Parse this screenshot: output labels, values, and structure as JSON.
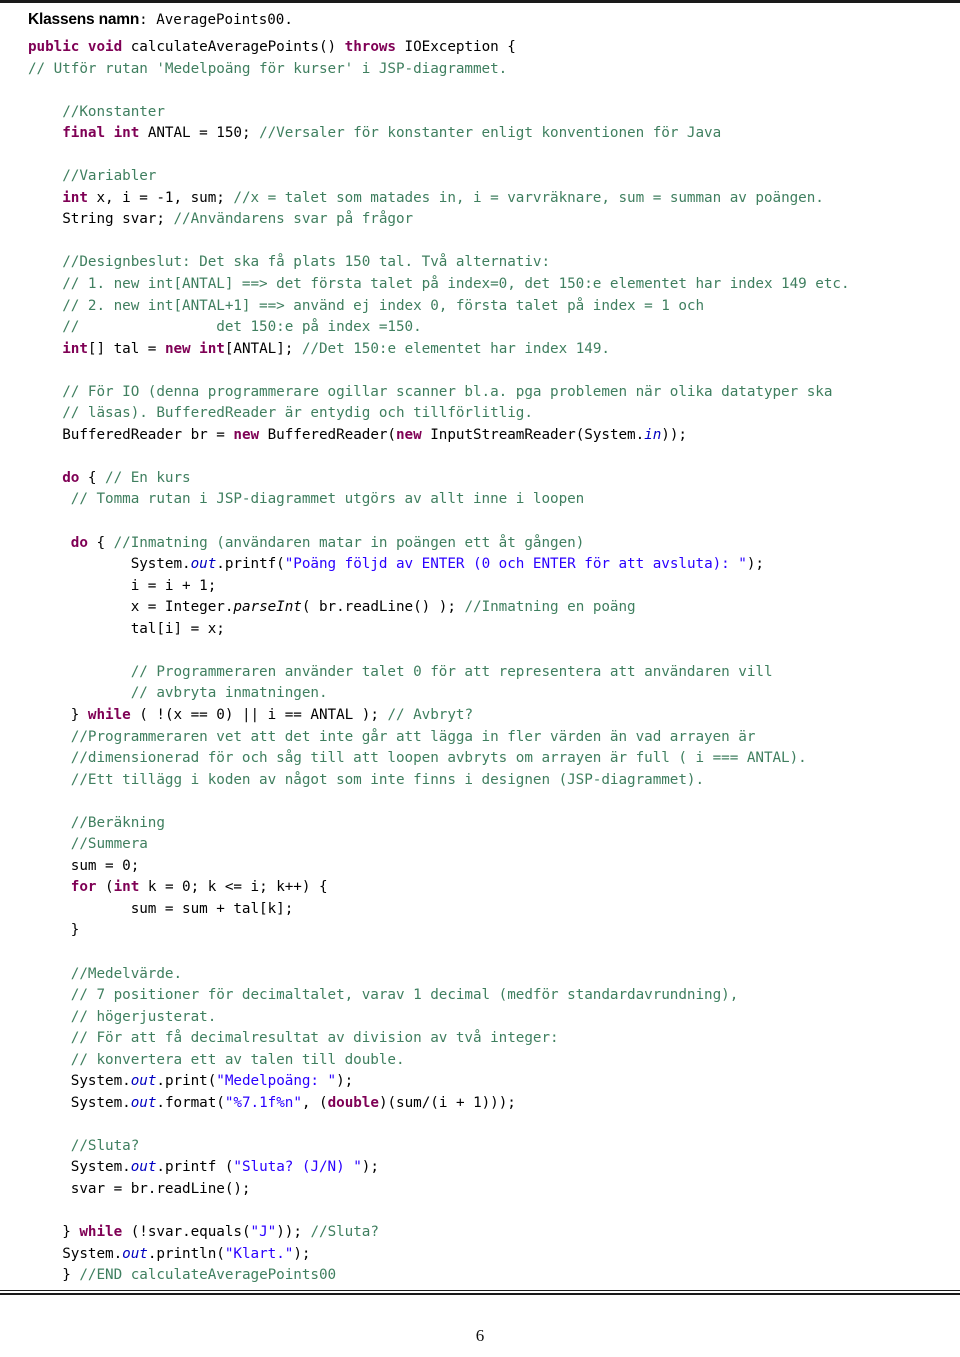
{
  "document": {
    "heading_label": "Klassens namn",
    "heading_value": ": AveragePoints00.",
    "page_number": "6",
    "colors": {
      "keyword": "#7f0055",
      "comment": "#3f7f5f",
      "string": "#2a00ff",
      "field": "#0000c0",
      "text": "#000000",
      "background": "#ffffff",
      "rule": "#1a1a1a"
    }
  },
  "code": {
    "language": "Java",
    "lines": [
      {
        "id": 1,
        "segments": [
          {
            "t": "kw",
            "s": "public void "
          },
          {
            "t": "pln",
            "s": "calculateAveragePoints() "
          },
          {
            "t": "kw",
            "s": "throws "
          },
          {
            "t": "pln",
            "s": "IOException {"
          }
        ]
      },
      {
        "id": 2,
        "segments": [
          {
            "t": "cmt",
            "s": "// Utför rutan 'Medelpoäng för kurser' i JSP-diagrammet."
          }
        ]
      },
      {
        "id": 3,
        "segments": []
      },
      {
        "id": 4,
        "segments": [
          {
            "t": "cmt",
            "s": "    //Konstanter"
          }
        ]
      },
      {
        "id": 5,
        "segments": [
          {
            "t": "kw",
            "s": "    final int "
          },
          {
            "t": "pln",
            "s": "ANTAL = 150; "
          },
          {
            "t": "cmt",
            "s": "//Versaler för konstanter enligt konventionen för Java"
          }
        ]
      },
      {
        "id": 6,
        "segments": []
      },
      {
        "id": 7,
        "segments": [
          {
            "t": "cmt",
            "s": "    //Variabler"
          }
        ]
      },
      {
        "id": 8,
        "segments": [
          {
            "t": "kw",
            "s": "    int "
          },
          {
            "t": "pln",
            "s": "x, i = -1, sum; "
          },
          {
            "t": "cmt",
            "s": "//x = talet som matades in, i = varvräknare, sum = summan av poängen."
          }
        ]
      },
      {
        "id": 9,
        "segments": [
          {
            "t": "pln",
            "s": "    String svar; "
          },
          {
            "t": "cmt",
            "s": "//Användarens svar på frågor"
          }
        ]
      },
      {
        "id": 10,
        "segments": []
      },
      {
        "id": 11,
        "segments": [
          {
            "t": "cmt",
            "s": "    //Designbeslut: Det ska få plats 150 tal. Två alternativ:"
          }
        ]
      },
      {
        "id": 12,
        "segments": [
          {
            "t": "cmt",
            "s": "    // 1. new int[ANTAL] ==> det första talet på index=0, det 150:e elementet har index 149 etc."
          }
        ]
      },
      {
        "id": 13,
        "segments": [
          {
            "t": "cmt",
            "s": "    // 2. new int[ANTAL+1] ==> använd ej index 0, första talet på index = 1 och"
          }
        ]
      },
      {
        "id": 14,
        "segments": [
          {
            "t": "cmt",
            "s": "    //                det 150:e på index =150."
          }
        ]
      },
      {
        "id": 15,
        "segments": [
          {
            "t": "kw",
            "s": "    int"
          },
          {
            "t": "pln",
            "s": "[] tal = "
          },
          {
            "t": "kw",
            "s": "new int"
          },
          {
            "t": "pln",
            "s": "[ANTAL]; "
          },
          {
            "t": "cmt",
            "s": "//Det 150:e elementet har index 149."
          }
        ]
      },
      {
        "id": 16,
        "segments": []
      },
      {
        "id": 17,
        "segments": [
          {
            "t": "cmt",
            "s": "    // För IO (denna programmerare ogillar scanner bl.a. pga problemen när olika datatyper ska"
          }
        ]
      },
      {
        "id": 18,
        "segments": [
          {
            "t": "cmt",
            "s": "    // läsas). BufferedReader är entydig och tillförlitlig."
          }
        ]
      },
      {
        "id": 19,
        "segments": [
          {
            "t": "pln",
            "s": "    BufferedReader br = "
          },
          {
            "t": "kw",
            "s": "new "
          },
          {
            "t": "pln",
            "s": "BufferedReader("
          },
          {
            "t": "kw",
            "s": "new "
          },
          {
            "t": "pln",
            "s": "InputStreamReader(System."
          },
          {
            "t": "fld",
            "s": "in"
          },
          {
            "t": "pln",
            "s": "));"
          }
        ]
      },
      {
        "id": 20,
        "segments": []
      },
      {
        "id": 21,
        "segments": [
          {
            "t": "kw",
            "s": "    do "
          },
          {
            "t": "pln",
            "s": "{ "
          },
          {
            "t": "cmt",
            "s": "// En kurs"
          }
        ]
      },
      {
        "id": 22,
        "segments": [
          {
            "t": "cmt",
            "s": "     // Tomma rutan i JSP-diagrammet utgörs av allt inne i loopen"
          }
        ]
      },
      {
        "id": 23,
        "segments": []
      },
      {
        "id": 24,
        "segments": [
          {
            "t": "kw",
            "s": "     do "
          },
          {
            "t": "pln",
            "s": "{ "
          },
          {
            "t": "cmt",
            "s": "//Inmatning (användaren matar in poängen ett åt gången)"
          }
        ]
      },
      {
        "id": 25,
        "segments": [
          {
            "t": "pln",
            "s": "            System."
          },
          {
            "t": "fld",
            "s": "out"
          },
          {
            "t": "pln",
            "s": ".printf("
          },
          {
            "t": "str",
            "s": "\"Poäng följd av ENTER (0 och ENTER för att avsluta): \""
          },
          {
            "t": "pln",
            "s": ");"
          }
        ]
      },
      {
        "id": 26,
        "segments": [
          {
            "t": "pln",
            "s": "            i = i + 1;"
          }
        ]
      },
      {
        "id": 27,
        "segments": [
          {
            "t": "pln",
            "s": "            x = Integer."
          },
          {
            "t": "mth",
            "s": "parseInt"
          },
          {
            "t": "pln",
            "s": "( br.readLine() ); "
          },
          {
            "t": "cmt",
            "s": "//Inmatning en poäng"
          }
        ]
      },
      {
        "id": 28,
        "segments": [
          {
            "t": "pln",
            "s": "            tal[i] = x;"
          }
        ]
      },
      {
        "id": 29,
        "segments": []
      },
      {
        "id": 30,
        "segments": [
          {
            "t": "cmt",
            "s": "            // Programmeraren använder talet 0 för att representera att användaren vill"
          }
        ]
      },
      {
        "id": 31,
        "segments": [
          {
            "t": "cmt",
            "s": "            // avbryta inmatningen."
          }
        ]
      },
      {
        "id": 32,
        "segments": [
          {
            "t": "pln",
            "s": "     } "
          },
          {
            "t": "kw",
            "s": "while "
          },
          {
            "t": "pln",
            "s": "( !(x == 0) || i == ANTAL ); "
          },
          {
            "t": "cmt",
            "s": "// Avbryt?"
          }
        ]
      },
      {
        "id": 33,
        "segments": [
          {
            "t": "cmt",
            "s": "     //Programmeraren vet att det inte går att lägga in fler värden än vad arrayen är"
          }
        ]
      },
      {
        "id": 34,
        "segments": [
          {
            "t": "cmt",
            "s": "     //dimensionerad för och såg till att loopen avbryts om arrayen är full ( i === ANTAL)."
          }
        ]
      },
      {
        "id": 35,
        "segments": [
          {
            "t": "cmt",
            "s": "     //Ett tillägg i koden av något som inte finns i designen (JSP-diagrammet)."
          }
        ]
      },
      {
        "id": 36,
        "segments": []
      },
      {
        "id": 37,
        "segments": [
          {
            "t": "cmt",
            "s": "     //Beräkning"
          }
        ]
      },
      {
        "id": 38,
        "segments": [
          {
            "t": "cmt",
            "s": "     //Summera"
          }
        ]
      },
      {
        "id": 39,
        "segments": [
          {
            "t": "pln",
            "s": "     sum = 0;"
          }
        ]
      },
      {
        "id": 40,
        "segments": [
          {
            "t": "kw",
            "s": "     for "
          },
          {
            "t": "pln",
            "s": "("
          },
          {
            "t": "kw",
            "s": "int "
          },
          {
            "t": "pln",
            "s": "k = 0; k <= i; k++) {"
          }
        ]
      },
      {
        "id": 41,
        "segments": [
          {
            "t": "pln",
            "s": "            sum = sum + tal[k];"
          }
        ]
      },
      {
        "id": 42,
        "segments": [
          {
            "t": "pln",
            "s": "     }"
          }
        ]
      },
      {
        "id": 43,
        "segments": []
      },
      {
        "id": 44,
        "segments": [
          {
            "t": "cmt",
            "s": "     //Medelvärde."
          }
        ]
      },
      {
        "id": 45,
        "segments": [
          {
            "t": "cmt",
            "s": "     // 7 positioner för decimaltalet, varav 1 decimal (medför standardavrundning),"
          }
        ]
      },
      {
        "id": 46,
        "segments": [
          {
            "t": "cmt",
            "s": "     // högerjusterat."
          }
        ]
      },
      {
        "id": 47,
        "segments": [
          {
            "t": "cmt",
            "s": "     // För att få decimalresultat av division av två integer:"
          }
        ]
      },
      {
        "id": 48,
        "segments": [
          {
            "t": "cmt",
            "s": "     // konvertera ett av talen till double."
          }
        ]
      },
      {
        "id": 49,
        "segments": [
          {
            "t": "pln",
            "s": "     System."
          },
          {
            "t": "fld",
            "s": "out"
          },
          {
            "t": "pln",
            "s": ".print("
          },
          {
            "t": "str",
            "s": "\"Medelpoäng: \""
          },
          {
            "t": "pln",
            "s": ");"
          }
        ]
      },
      {
        "id": 50,
        "segments": [
          {
            "t": "pln",
            "s": "     System."
          },
          {
            "t": "fld",
            "s": "out"
          },
          {
            "t": "pln",
            "s": ".format("
          },
          {
            "t": "str",
            "s": "\"%7.1f%n\""
          },
          {
            "t": "pln",
            "s": ", ("
          },
          {
            "t": "kw",
            "s": "double"
          },
          {
            "t": "pln",
            "s": ")(sum/(i + 1)));"
          }
        ]
      },
      {
        "id": 51,
        "segments": []
      },
      {
        "id": 52,
        "segments": [
          {
            "t": "cmt",
            "s": "     //Sluta?"
          }
        ]
      },
      {
        "id": 53,
        "segments": [
          {
            "t": "pln",
            "s": "     System."
          },
          {
            "t": "fld",
            "s": "out"
          },
          {
            "t": "pln",
            "s": ".printf ("
          },
          {
            "t": "str",
            "s": "\"Sluta? (J/N) \""
          },
          {
            "t": "pln",
            "s": ");"
          }
        ]
      },
      {
        "id": 54,
        "segments": [
          {
            "t": "pln",
            "s": "     svar = br.readLine();"
          }
        ]
      },
      {
        "id": 55,
        "segments": []
      },
      {
        "id": 56,
        "segments": [
          {
            "t": "pln",
            "s": "    } "
          },
          {
            "t": "kw",
            "s": "while "
          },
          {
            "t": "pln",
            "s": "(!svar.equals("
          },
          {
            "t": "str",
            "s": "\"J\""
          },
          {
            "t": "pln",
            "s": ")); "
          },
          {
            "t": "cmt",
            "s": "//Sluta?"
          }
        ]
      },
      {
        "id": 57,
        "segments": [
          {
            "t": "pln",
            "s": "    System."
          },
          {
            "t": "fld",
            "s": "out"
          },
          {
            "t": "pln",
            "s": ".println("
          },
          {
            "t": "str",
            "s": "\"Klart.\""
          },
          {
            "t": "pln",
            "s": ");"
          }
        ]
      },
      {
        "id": 58,
        "segments": [
          {
            "t": "pln",
            "s": "    } "
          },
          {
            "t": "cmt",
            "s": "//END calculateAveragePoints00"
          }
        ]
      }
    ]
  }
}
